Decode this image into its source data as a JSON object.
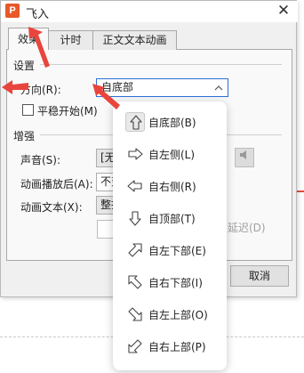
{
  "window": {
    "app_icon_letter": "P",
    "title": "飞入",
    "close_glyph": "✕"
  },
  "tabs": [
    {
      "label": "效果"
    },
    {
      "label": "计时"
    },
    {
      "label": "正文文本动画"
    }
  ],
  "settings": {
    "section_label": "设置",
    "direction_label": "方向(R):",
    "direction_value": "自底部",
    "smooth_start_label": "平稳开始(M)"
  },
  "enhance": {
    "section_label": "增强",
    "sound_label": "声音(S):",
    "sound_value": "[无",
    "after_animation_label": "动画播放后(A):",
    "after_animation_value": "不变",
    "animate_text_label": "动画文本(X):",
    "animate_text_value": "整批",
    "delay_label": "延迟(D)"
  },
  "buttons": {
    "cancel": "取消"
  },
  "dropdown": {
    "items": [
      {
        "label": "自底部(B)",
        "icon": "arrow-up-icon",
        "selected": true
      },
      {
        "label": "自左侧(L)",
        "icon": "arrow-right-icon",
        "selected": false
      },
      {
        "label": "自右侧(R)",
        "icon": "arrow-left-icon",
        "selected": false
      },
      {
        "label": "自顶部(T)",
        "icon": "arrow-down-icon",
        "selected": false
      },
      {
        "label": "自左下部(E)",
        "icon": "arrow-up-right-icon",
        "selected": false
      },
      {
        "label": "自右下部(I)",
        "icon": "arrow-up-left-icon",
        "selected": false
      },
      {
        "label": "自左上部(O)",
        "icon": "arrow-down-right-icon",
        "selected": false
      },
      {
        "label": "自右上部(P)",
        "icon": "arrow-down-left-icon",
        "selected": false
      }
    ]
  },
  "colors": {
    "annotation_arrow": "#e8453c",
    "app_icon": "#e8582a",
    "focus_border": "#2b6fd6"
  }
}
